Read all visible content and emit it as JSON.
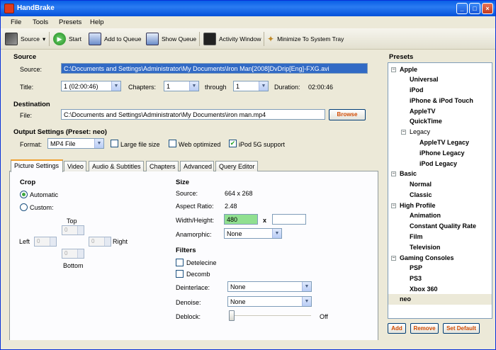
{
  "window": {
    "title": "HandBrake"
  },
  "menu": [
    "File",
    "Tools",
    "Presets",
    "Help"
  ],
  "toolbar": {
    "source": "Source",
    "start": "Start",
    "add_queue": "Add to Queue",
    "show_queue": "Show Queue",
    "activity": "Activity Window",
    "minimize": "Minimize To System Tray"
  },
  "source": {
    "section": "Source",
    "source_label": "Source:",
    "source_value": "C:\\Documents and Settings\\Administrator\\My Documents\\Iron Man[2008]DvDrip[Eng]-FXG.avi",
    "title_label": "Title:",
    "title_value": "1 (02:00:46)",
    "chapters_label": "Chapters:",
    "chapter_start": "1",
    "through_label": "through",
    "chapter_end": "1",
    "duration_label": "Duration:",
    "duration_value": "02:00:46"
  },
  "destination": {
    "section": "Destination",
    "file_label": "File:",
    "file_value": "C:\\Documents and Settings\\Administrator\\My Documents\\iron man.mp4",
    "browse": "Browse"
  },
  "output": {
    "section": "Output Settings (Preset: neo)",
    "format_label": "Format:",
    "format_value": "MP4 File",
    "large_file": "Large file size",
    "web_optimized": "Web optimized",
    "ipod": "iPod 5G support"
  },
  "tabs": [
    "Picture Settings",
    "Video",
    "Audio & Subtitles",
    "Chapters",
    "Advanced",
    "Query Editor"
  ],
  "picture": {
    "crop": "Crop",
    "automatic": "Automatic",
    "custom": "Custom:",
    "top": "Top",
    "left": "Left",
    "right": "Right",
    "bottom": "Bottom",
    "crop_values": [
      "0",
      "0",
      "0",
      "0"
    ],
    "size": "Size",
    "source_label": "Source:",
    "source_value": "664 x 268",
    "aspect_label": "Aspect Ratio:",
    "aspect_value": "2.48",
    "wh_label": "Width/Height:",
    "width_value": "480",
    "x": "x",
    "height_value": "",
    "anamorphic_label": "Anamorphic:",
    "anamorphic_value": "None",
    "filters": "Filters",
    "detelecine": "Detelecine",
    "decomb": "Decomb",
    "deinterlace_label": "Deinterlace:",
    "deinterlace_value": "None",
    "denoise_label": "Denoise:",
    "denoise_value": "None",
    "deblock_label": "Deblock:",
    "deblock_value": "Off"
  },
  "presets": {
    "header": "Presets",
    "apple": "Apple",
    "universal": "Universal",
    "ipod": "iPod",
    "iphone": "iPhone & iPod Touch",
    "appletv": "AppleTV",
    "quicktime": "QuickTime",
    "legacy": "Legacy",
    "appletv_legacy": "AppleTV Legacy",
    "iphone_legacy": "iPhone Legacy",
    "ipod_legacy": "iPod Legacy",
    "basic": "Basic",
    "normal": "Normal",
    "classic": "Classic",
    "high_profile": "High Profile",
    "animation": "Animation",
    "cqr": "Constant Quality Rate",
    "film": "Film",
    "television": "Television",
    "gaming": "Gaming Consoles",
    "psp": "PSP",
    "ps3": "PS3",
    "xbox": "Xbox 360",
    "neo": "neo",
    "add": "Add",
    "remove": "Remove",
    "set_default": "Set Default"
  },
  "colors": {
    "width_highlight": "#90E090",
    "accent": "#316AC5"
  }
}
